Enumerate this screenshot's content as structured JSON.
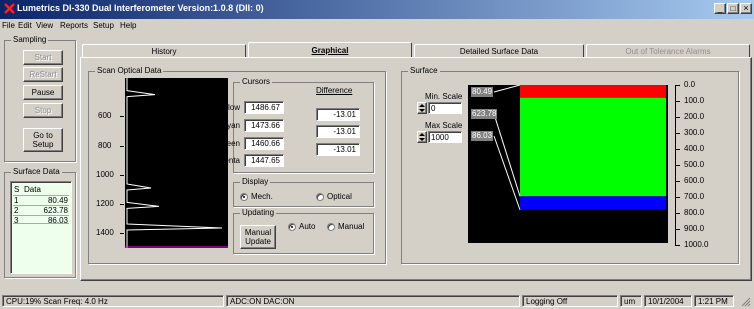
{
  "window": {
    "title": "Lumetrics DI-330 Dual Interferometer  Version:1.0.8  (DII: 0)",
    "controls": [
      "_",
      "□",
      "×"
    ]
  },
  "menu": [
    "File",
    "Edit",
    "View",
    "Reports",
    "Setup",
    "Help"
  ],
  "sampling": {
    "label": "Sampling",
    "buttons": [
      {
        "label": "Start",
        "enabled": false
      },
      {
        "label": "ReStart",
        "enabled": false
      },
      {
        "label": "Pause",
        "enabled": true
      },
      {
        "label": "Stop",
        "enabled": false
      }
    ],
    "setup_button": "Go to Setup"
  },
  "surface_data": {
    "label": "Surface Data",
    "columns": [
      "S",
      "Data"
    ],
    "rows": [
      [
        "1",
        "80.49"
      ],
      [
        "2",
        "623.78"
      ],
      [
        "3",
        "86.03"
      ]
    ]
  },
  "tabs": [
    {
      "label": "History",
      "active": false,
      "enabled": true
    },
    {
      "label": "Graphical",
      "active": true,
      "enabled": true
    },
    {
      "label": "Detailed Surface Data",
      "active": false,
      "enabled": true
    },
    {
      "label": "Out of Tolerance Alarms",
      "active": false,
      "enabled": false
    }
  ],
  "scan": {
    "label": "Scan Optical Data",
    "y_ticks": [
      "600",
      "800",
      "1000",
      "1200",
      "1400"
    ],
    "peaks": [
      1400,
      600,
      1160,
      1270
    ]
  },
  "cursors": {
    "label": "Cursors",
    "difference_label": "Difference",
    "items": [
      {
        "name": "Yellow",
        "value": "1486.67",
        "diff": "-13.01"
      },
      {
        "name": "Cyan",
        "value": "1473.66",
        "diff": "-13.01"
      },
      {
        "name": "Green",
        "value": "1460.66",
        "diff": "-13.01"
      },
      {
        "name": "Magenta",
        "value": "1447.65"
      }
    ]
  },
  "display": {
    "label": "Display",
    "options": [
      {
        "label": "Mech.",
        "selected": true
      },
      {
        "label": "Optical",
        "selected": false
      }
    ]
  },
  "updating": {
    "label": "Updating",
    "manual_button": "Manual Update",
    "options": [
      {
        "label": "Auto",
        "selected": true
      },
      {
        "label": "Manual",
        "selected": false
      }
    ]
  },
  "surface": {
    "label": "Surface",
    "min_scale_label": "Min. Scale",
    "min_scale_value": "0",
    "max_scale_label": "Max Scale",
    "max_scale_value": "1000",
    "markers": [
      "80.49",
      "623.78",
      "86.03"
    ],
    "axis_ticks": [
      "0.0",
      "100.0",
      "200.0",
      "300.0",
      "400.0",
      "500.0",
      "600.0",
      "700.0",
      "800.0",
      "900.0",
      "1000.0"
    ],
    "scale_min": 0,
    "scale_max": 1000,
    "layers": [
      {
        "color": "#ff0000",
        "thickness": 80.49
      },
      {
        "color": "#00ff00",
        "thickness": 623.78
      },
      {
        "color": "#0000ff",
        "thickness": 86.03
      }
    ]
  },
  "status": {
    "cpu": "CPU:19% Scan Freq: 4.0 Hz",
    "adc": "ADC:ON DAC:ON",
    "logging": "Logging Off",
    "units": "um",
    "date": "10/1/2004",
    "time": "1:21 PM"
  }
}
